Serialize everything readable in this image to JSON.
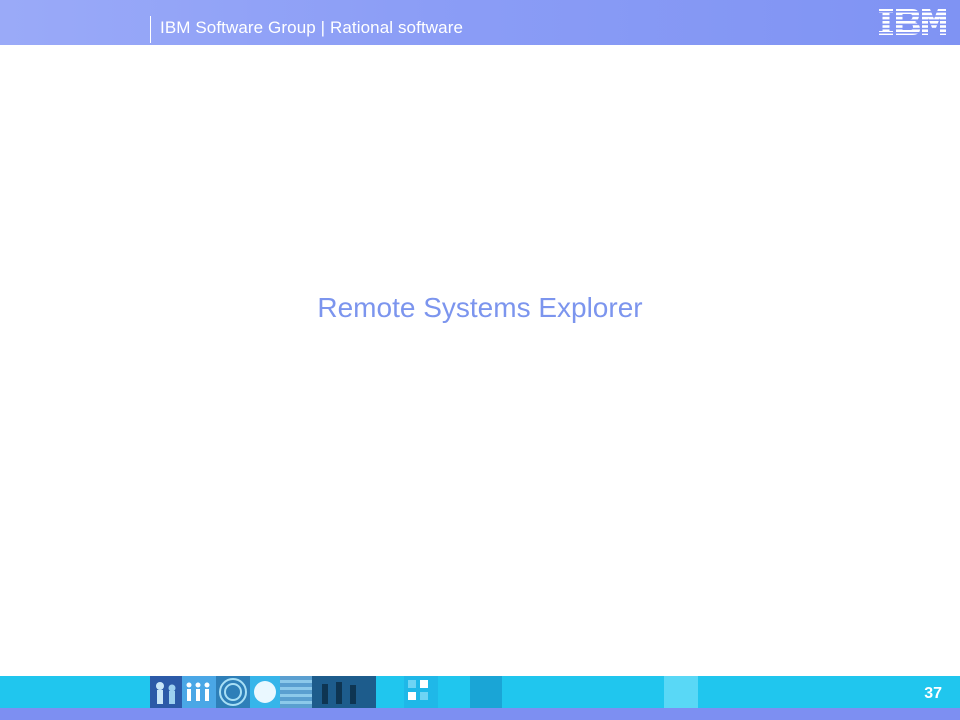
{
  "header": {
    "title": "IBM Software Group | Rational software",
    "logo_icon": "ibm-logo",
    "background": "#8b9df6"
  },
  "slide": {
    "title": "Remote Systems Explorer",
    "title_color": "#7c95ee"
  },
  "footer": {
    "page_number": "37",
    "background": "#20c6ee",
    "strip_color": "#7d8ff2",
    "art_icon": "decorative-image-strip"
  }
}
